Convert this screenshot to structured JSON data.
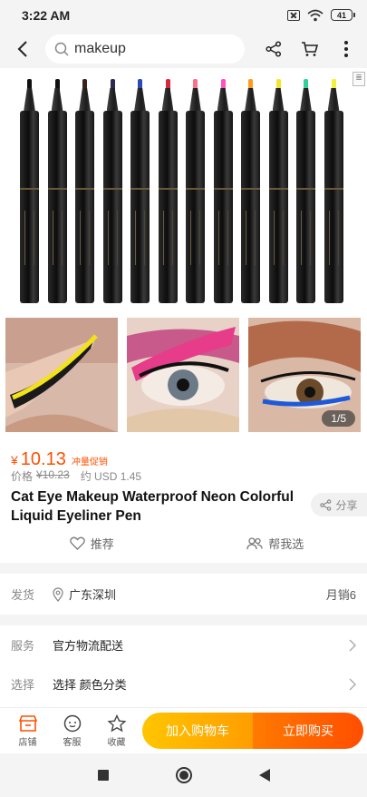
{
  "status": {
    "time": "3:22 AM",
    "battery": "41"
  },
  "search": {
    "value": "makeup"
  },
  "product": {
    "pen_tip_colors": [
      "#111111",
      "#111111",
      "#3a2418",
      "#2b2b55",
      "#2b4bb5",
      "#d8263c",
      "#ff6f8a",
      "#ff4fc2",
      "#ff9a1a",
      "#f5e52a",
      "#30d09a",
      "#f2f03a"
    ],
    "image_counter": "1/5",
    "currency": "¥",
    "price": "10.13",
    "promo_tag": "冲量促销",
    "orig_label": "价格",
    "orig_price": "¥10.23",
    "usd": "约 USD 1.45",
    "title": "Cat Eye Makeup Waterproof Neon Colorful Liquid Eyeliner Pen",
    "share": "分享",
    "recommend": "推荐",
    "help_choose": "帮我选"
  },
  "shipping": {
    "label": "发货",
    "location": "广东深圳",
    "monthly_sales": "月销6"
  },
  "service": {
    "label": "服务",
    "value": "官方物流配送"
  },
  "selection": {
    "label": "选择",
    "value": "选择 颜色分类"
  },
  "bottom": {
    "shop": "店铺",
    "service": "客服",
    "favorite": "收藏",
    "add_to_cart": "加入购物车",
    "buy_now": "立即购买"
  },
  "colors": {
    "accent": "#ff5000",
    "cart_btn": "#ffb000",
    "buy_btn": "#ff5a00"
  }
}
